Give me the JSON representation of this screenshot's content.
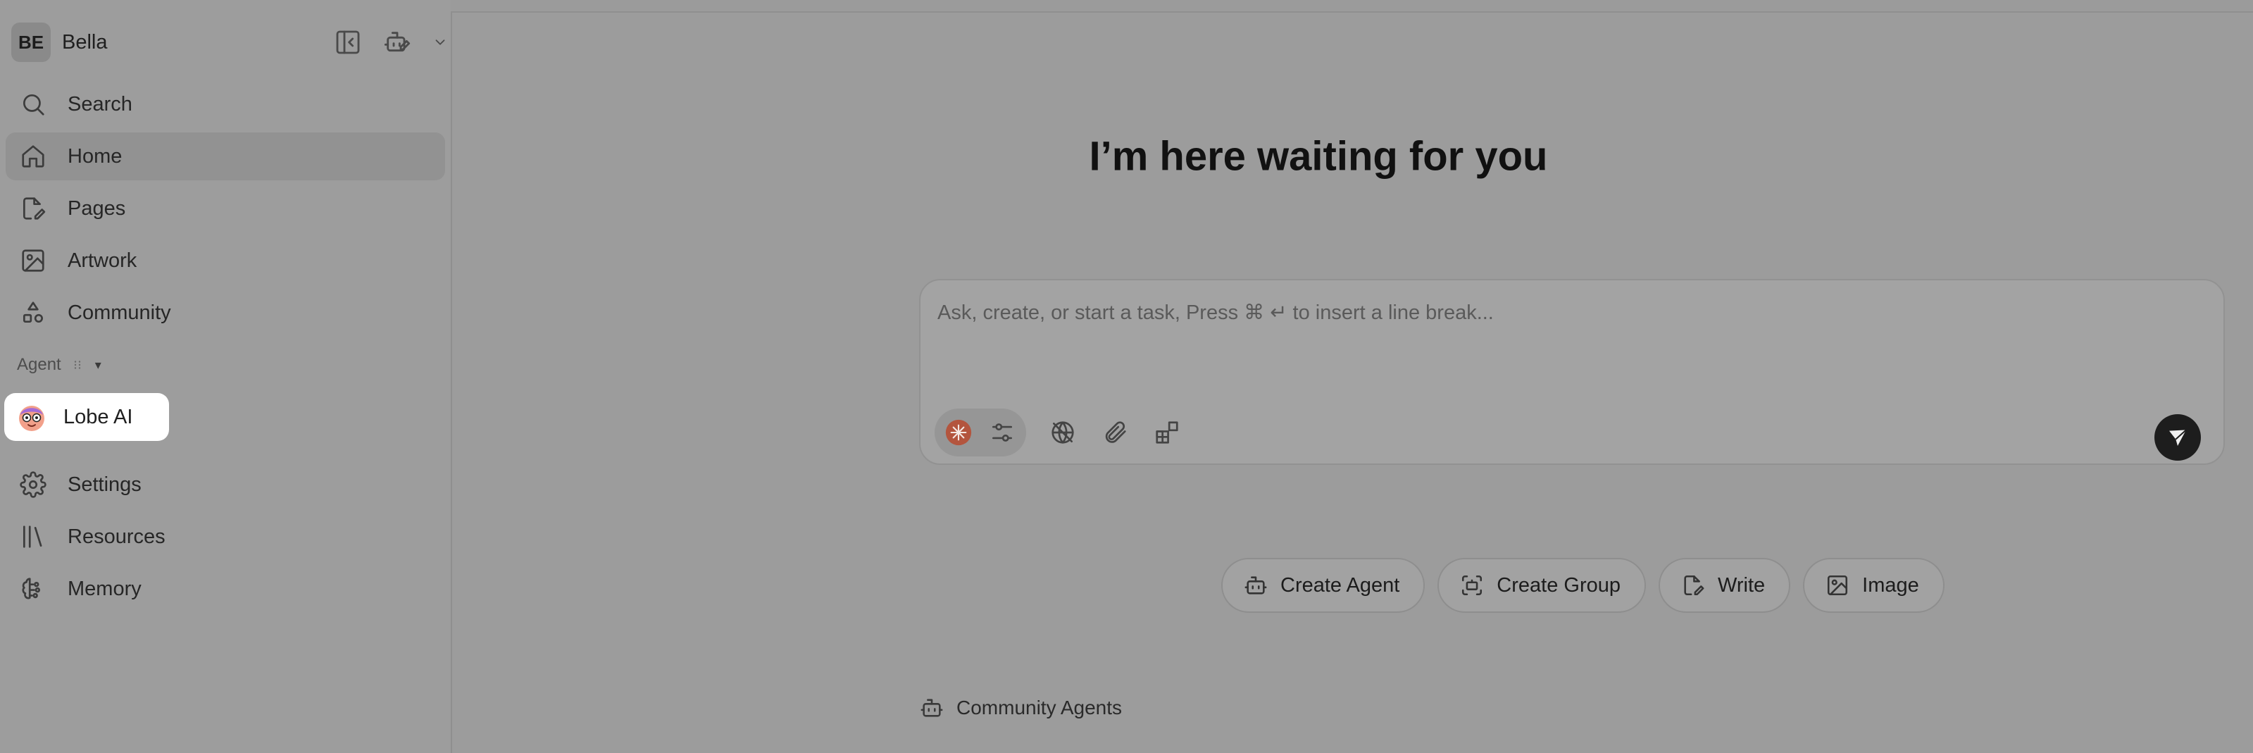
{
  "user": {
    "initials": "BE",
    "name": "Bella"
  },
  "icons": {
    "collapse": "sidebar-collapse-icon",
    "new_agent": "robot-edit-icon",
    "search": "search-icon",
    "home": "home-icon",
    "pages": "page-edit-icon",
    "artwork": "image-icon",
    "community": "shapes-icon",
    "settings": "gear-icon",
    "resources": "library-icon",
    "memory": "brain-icon"
  },
  "nav": {
    "search": "Search",
    "home": "Home",
    "pages": "Pages",
    "artwork": "Artwork",
    "community": "Community",
    "settings": "Settings",
    "resources": "Resources",
    "memory": "Memory"
  },
  "agent_section": {
    "label": "Agent",
    "caret": "▾"
  },
  "agents": [
    {
      "name": "Lobe AI"
    }
  ],
  "main": {
    "heading": "I’m here waiting for you",
    "chat": {
      "placeholder": "Ask, create, or start a task, Press ⌘ ↵ to insert a line break..."
    },
    "quick_actions": [
      {
        "label": "Create Agent",
        "icon": "robot-icon"
      },
      {
        "label": "Create Group",
        "icon": "group-scan-icon"
      },
      {
        "label": "Write",
        "icon": "page-edit-icon"
      },
      {
        "label": "Image",
        "icon": "image-icon"
      }
    ],
    "community_agents": "Community Agents"
  },
  "colors": {
    "accent_model": "#b3553e",
    "send_button": "#1d1d1d",
    "highlight": "#ffffff"
  }
}
